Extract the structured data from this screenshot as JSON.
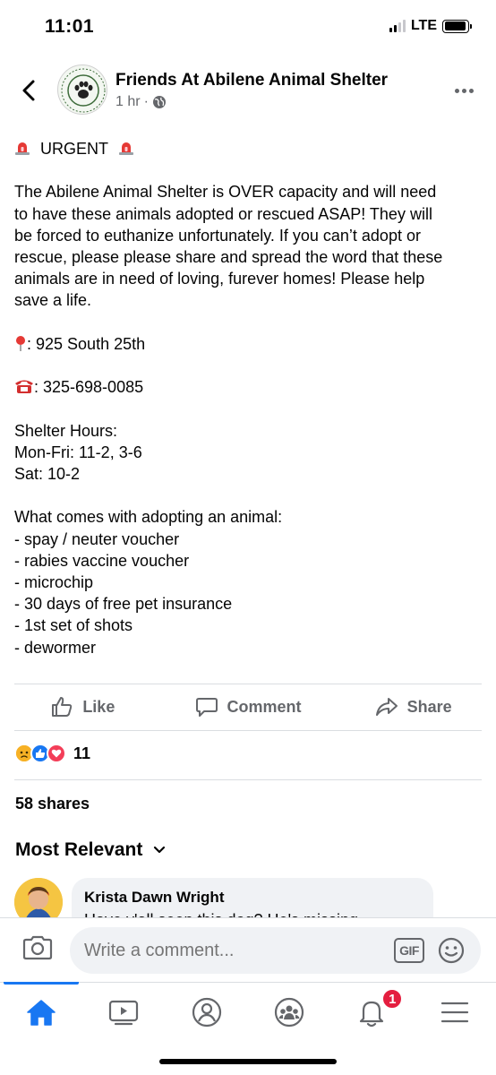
{
  "status_bar": {
    "time": "11:01",
    "network": "LTE",
    "signal_bars": 2,
    "battery_level": 0.95
  },
  "post": {
    "page_name": "Friends At Abilene Animal Shelter",
    "time": "1 hr",
    "separator": "·",
    "audience_icon": "globe-icon",
    "urgent_label": "URGENT",
    "body_lines": [
      "The Abilene Animal Shelter is OVER capacity and will need",
      "to have these animals adopted or rescued ASAP! They will",
      "be forced to euthanize unfortunately. If you can’t adopt or",
      "rescue, please please share and spread the word that these",
      "animals are in need of loving, furever homes! Please help",
      "save a life."
    ],
    "address": ": 925 South 25th",
    "phone": ": 325-698-0085",
    "hours": [
      "Shelter Hours:",
      "Mon-Fri: 11-2, 3-6",
      "Sat: 10-2"
    ],
    "benefits_title": "What comes with adopting an animal:",
    "benefits": [
      "- spay / neuter voucher",
      "- rabies vaccine voucher",
      "- microchip",
      "- 30 days of free pet insurance",
      "- 1st set of shots",
      "- dewormer"
    ]
  },
  "actions": {
    "like": "Like",
    "comment": "Comment",
    "share": "Share"
  },
  "reactions": {
    "types": [
      "sad",
      "like",
      "love"
    ],
    "count": "11"
  },
  "shares": "58 shares",
  "comments": {
    "sort_label": "Most Relevant",
    "preview": {
      "author": "Krista Dawn Wright",
      "text": "Have y'all seen this dog? He's missing"
    }
  },
  "composer": {
    "placeholder": "Write a comment...",
    "gif_label": "GIF"
  },
  "tab_bar": {
    "tabs": [
      "home-icon",
      "watch-icon",
      "profile-icon",
      "groups-icon",
      "notifications-icon",
      "menu-icon"
    ],
    "active": "home-icon",
    "notification_badge": "1"
  },
  "colors": {
    "accent": "#1877f2",
    "badge": "#e41e3f",
    "muted": "#65676b",
    "bubble": "#f0f2f5"
  }
}
